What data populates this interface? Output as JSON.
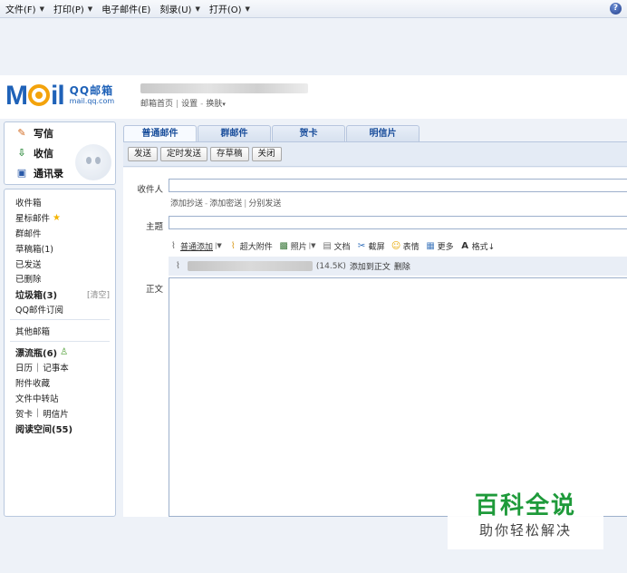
{
  "menubar": {
    "items": [
      {
        "label": "文件(F)"
      },
      {
        "label": "打印(P)"
      },
      {
        "label": "电子邮件(E)"
      },
      {
        "label": "刻录(U)"
      },
      {
        "label": "打开(O)"
      }
    ],
    "help": "?"
  },
  "header": {
    "logo_text": "M",
    "logo_text_tail": "il",
    "logo_cn": "QQ邮箱",
    "logo_url": "mail.qq.com",
    "links": [
      "邮箱首页",
      "设置",
      "换肤"
    ]
  },
  "sidebar": {
    "actions": [
      {
        "label": "写信",
        "icon": "pencil-icon"
      },
      {
        "label": "收信",
        "icon": "inbox-icon"
      },
      {
        "label": "通讯录",
        "icon": "contacts-icon"
      }
    ],
    "folders": {
      "inbox": "收件箱",
      "starred": "星标邮件",
      "group": "群邮件",
      "drafts": "草稿箱(1)",
      "sent": "已发送",
      "deleted": "已删除",
      "spam": "垃圾箱(3)",
      "spam_clear": "[清空]",
      "subscribe": "QQ邮件订阅",
      "other": "其他邮箱",
      "bottle": "漂流瓶(6)",
      "calendar": "日历",
      "notebook": "记事本",
      "attachments": "附件收藏",
      "transfer": "文件中转站",
      "card": "贺卡",
      "postcard": "明信片",
      "reading": "阅读空间(55)"
    }
  },
  "compose": {
    "tabs": [
      "普通邮件",
      "群邮件",
      "贺卡",
      "明信片"
    ],
    "toolbar": {
      "send": "发送",
      "timed": "定时发送",
      "draft": "存草稿",
      "close": "关闭"
    },
    "to_label": "收件人",
    "cc_links": [
      "添加抄送",
      "添加密送",
      "分别发送"
    ],
    "subject_label": "主题",
    "body_label": "正文",
    "editor": {
      "attach": "普通添加",
      "big_attach": "超大附件",
      "photo": "照片",
      "doc": "文档",
      "screenshot": "截屏",
      "emoji": "表情",
      "more": "更多",
      "format": "格式↓"
    },
    "attachment": {
      "size": "(14.5K)",
      "add_to_body": "添加到正文",
      "delete": "删除"
    }
  },
  "watermark": {
    "title": "百科全说",
    "subtitle": "助你轻松解决"
  },
  "colors": {
    "accent": "#1f62b8",
    "logo_orange": "#f3a30c",
    "watermark_green": "#1e9a3a"
  }
}
